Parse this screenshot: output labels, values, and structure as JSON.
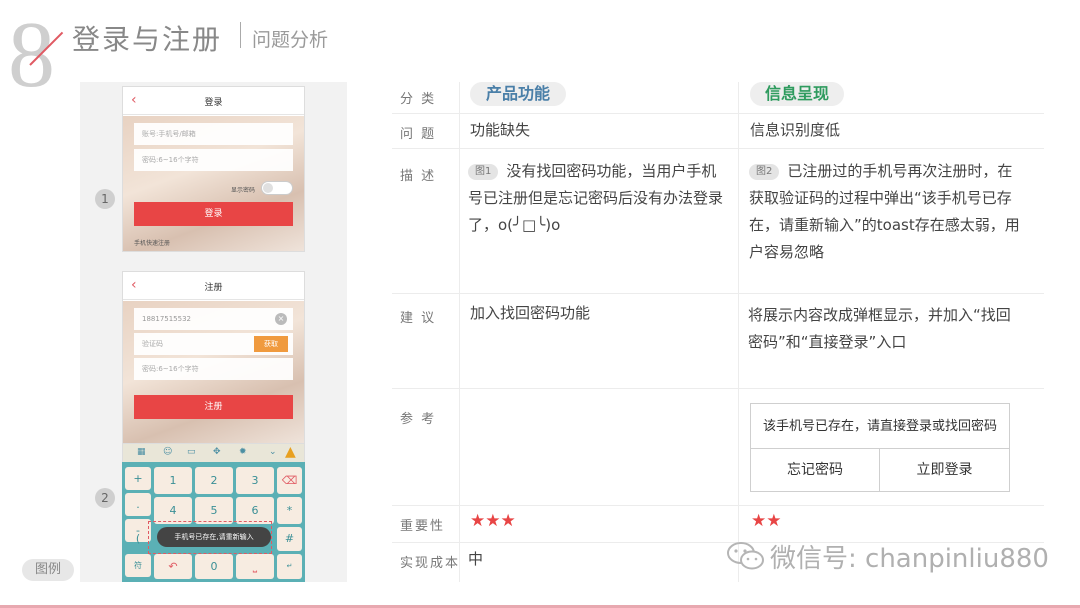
{
  "header": {
    "number": "8",
    "title": "登录与注册",
    "subtitle": "问题分析"
  },
  "figure": {
    "label": "图例",
    "step1": "1",
    "step2": "2",
    "login": {
      "title": "登录",
      "account_placeholder": "账号:手机号/邮箱",
      "password_placeholder": "密码:6~16个字符",
      "remember_label": "显示密码",
      "login_button": "登录",
      "quick_register": "手机快速注册"
    },
    "register": {
      "title": "注册",
      "phone_value": "18817515532",
      "code_placeholder": "验证码",
      "get_code_button": "获取",
      "password_placeholder": "密码:6~16个字符",
      "register_button": "注册",
      "toast": "手机号已存在,请重新输入",
      "keys": [
        "1",
        "2",
        "3",
        "4",
        "5",
        "6",
        "0"
      ]
    }
  },
  "table": {
    "labels": {
      "category": "分 类",
      "problem": "问 题",
      "description": "描 述",
      "suggestion": "建 议",
      "reference": "参 考",
      "importance": "重要性",
      "cost": "实现成本"
    },
    "col1": {
      "category": "产品功能",
      "category_color": "#4a7fa8",
      "problem": "功能缺失",
      "desc_tag": "图1",
      "description": "没有找回密码功能，当用户手机号已注册但是忘记密码后没有办法登录了，o(╯□╰)o",
      "suggestion": "加入找回密码功能",
      "importance": "★★★",
      "cost": "中"
    },
    "col2": {
      "category": "信息呈现",
      "category_color": "#2e9b5e",
      "problem": "信息识别度低",
      "desc_tag": "图2",
      "description": "已注册过的手机号再次注册时，在获取验证码的过程中弹出“该手机号已存在，请重新输入”的toast存在感太弱，用户容易忽略",
      "suggestion": "将展示内容改成弹框显示，并加入“找回密码”和“直接登录”入口",
      "importance": "★★",
      "dialog": {
        "message": "该手机号已存在，请直接登录或找回密码",
        "left_button": "忘记密码",
        "right_button": "立即登录"
      }
    }
  },
  "watermark": "微信号: chanpinliu880"
}
